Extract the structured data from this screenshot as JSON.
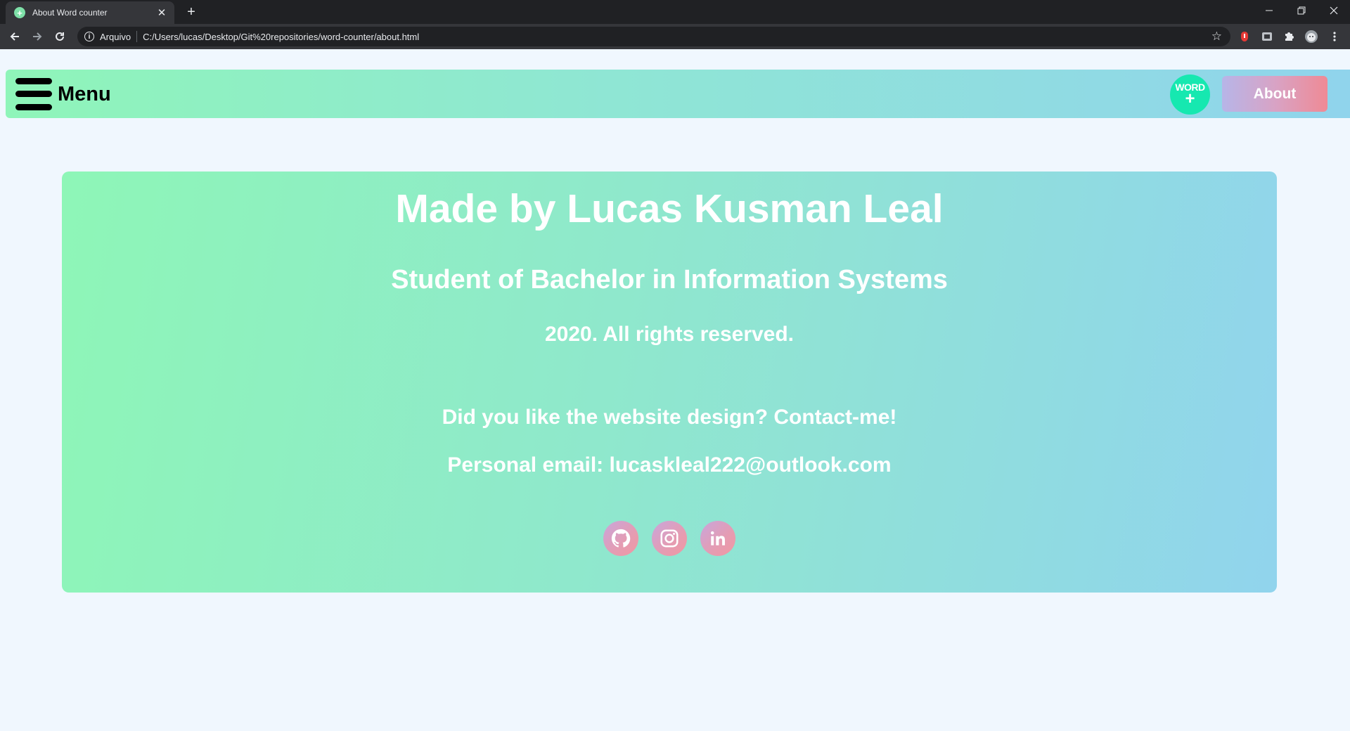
{
  "browser": {
    "tab_title": "About Word counter",
    "scheme_label": "Arquivo",
    "url": "C:/Users/lucas/Desktop/Git%20repositories/word-counter/about.html"
  },
  "navbar": {
    "menu_label": "Menu",
    "logo_text": "WORD",
    "logo_plus": "+",
    "about_label": "About"
  },
  "card": {
    "title": "Made by Lucas Kusman Leal",
    "subtitle": "Student of Bachelor in Information Systems",
    "copyright": "2020. All rights reserved.",
    "contact": "Did you like the website design? Contact-me!",
    "email": "Personal email: lucaskleal222@outlook.com",
    "socials": [
      "github-icon",
      "instagram-icon",
      "linkedin-icon"
    ]
  },
  "colors": {
    "gradient_start": "#8ff5b9",
    "gradient_end": "#90d4ec",
    "about_start": "#b7b5e8",
    "about_end": "#ef8a95",
    "logo": "#16e8b0",
    "page_bg": "#f0f7fe"
  }
}
